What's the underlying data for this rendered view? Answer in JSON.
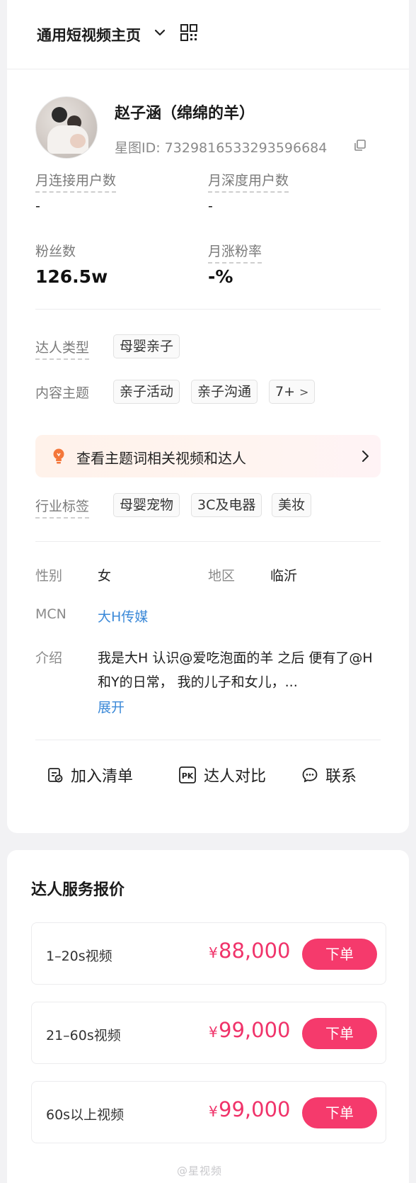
{
  "header": {
    "title": "通用短视频主页",
    "dropdown_icon": "chevron-down-icon",
    "qr_icon": "qrcode-icon"
  },
  "profile": {
    "name": "赵子涵（绵绵的羊）",
    "star_id": "星图ID: 7329816533293596684",
    "copy_icon": "copy-icon"
  },
  "metrics": [
    {
      "label": "月连接用户数",
      "value": "-"
    },
    {
      "label": "月深度用户数",
      "value": "-"
    },
    {
      "label": "粉丝数",
      "value": "126.5w"
    },
    {
      "label": "月涨粉率",
      "value": "-%"
    }
  ],
  "tags": {
    "talent_type_label": "达人类型",
    "talent_type": [
      "母婴亲子"
    ],
    "content_theme_label": "内容主题",
    "content_themes": [
      "亲子活动",
      "亲子沟通"
    ],
    "content_theme_more": "7+",
    "banner_text": "查看主题词相关视频和达人",
    "industry_label": "行业标签",
    "industry_tags": [
      "母婴宠物",
      "3C及电器",
      "美妆"
    ]
  },
  "info": {
    "gender_label": "性别",
    "gender": "女",
    "region_label": "地区",
    "region": "临沂",
    "mcn_label": "MCN",
    "mcn": "大H传媒",
    "intro_label": "介绍",
    "intro": "我是大H 认识@爱吃泡面的羊 之后 便有了@H和Y的日常， 我的儿子和女儿，...",
    "expand": "展开"
  },
  "actions": {
    "add_list": "加入清单",
    "compare": "达人对比",
    "contact": "联系"
  },
  "pricing": {
    "title": "达人服务报价",
    "currency": "¥",
    "order_label": "下单",
    "items": [
      {
        "name": "1–20s视频",
        "price": "88,000"
      },
      {
        "name": "21–60s视频",
        "price": "99,000"
      },
      {
        "name": "60s以上视频",
        "price": "99,000"
      }
    ]
  },
  "watermark": "@星视频",
  "colors": {
    "accent_pink": "#f53a6c",
    "price_pink": "#f0336a",
    "link_blue": "#3b89d8"
  }
}
